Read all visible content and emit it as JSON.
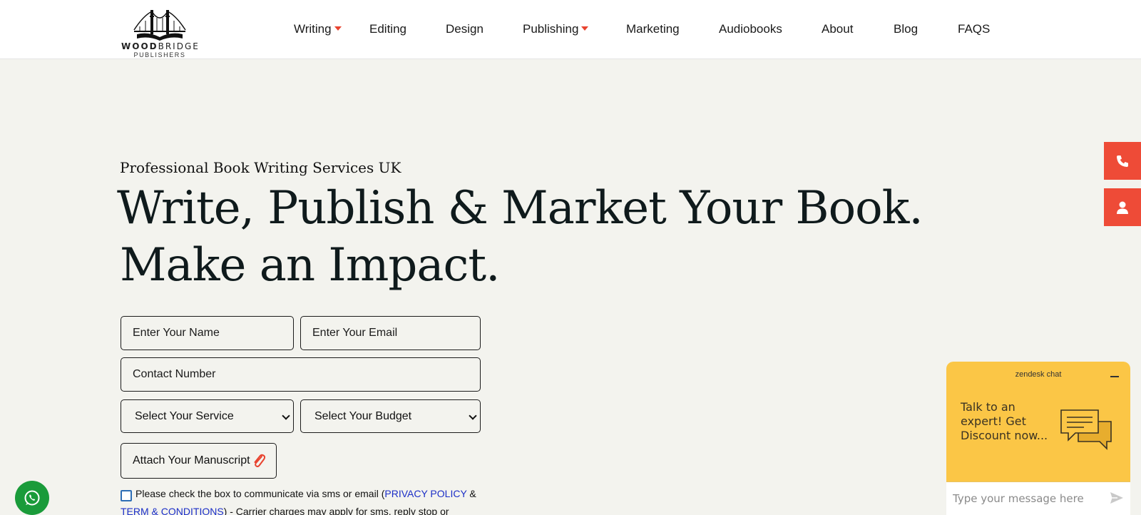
{
  "brand": {
    "logo_main_bold": "WOOD",
    "logo_main_light": "BRIDGE",
    "logo_sub": "PUBLISHERS"
  },
  "nav": {
    "items": [
      {
        "label": "Writing",
        "has_dropdown": true
      },
      {
        "label": "Editing",
        "has_dropdown": false
      },
      {
        "label": "Design",
        "has_dropdown": false
      },
      {
        "label": "Publishing",
        "has_dropdown": true
      },
      {
        "label": "Marketing",
        "has_dropdown": false
      },
      {
        "label": "Audiobooks",
        "has_dropdown": false
      },
      {
        "label": "About",
        "has_dropdown": false
      },
      {
        "label": "Blog",
        "has_dropdown": false
      },
      {
        "label": "FAQS",
        "has_dropdown": false
      }
    ]
  },
  "hero": {
    "eyebrow": "Professional Book Writing Services UK",
    "headline_line1": "Write, Publish & Market Your Book.",
    "headline_line2": "Make an Impact."
  },
  "form": {
    "name_placeholder": "Enter Your Name",
    "email_placeholder": "Enter Your Email",
    "phone_placeholder": "Contact Number",
    "service_selected": "Select Your Service",
    "budget_selected": "Select Your Budget",
    "attach_label": "Attach Your Manuscript",
    "consent_prefix": "Please check the box to communicate via sms or email (",
    "privacy_link": "PRIVACY POLICY",
    "consent_amp": " &",
    "terms_link": "TERM & CONDITIONS",
    "consent_suffix": ") - Carrier charges may apply for sms, reply stop or"
  },
  "chat": {
    "brand": "zendesk chat",
    "message": "Talk to an expert! Get Discount now...",
    "input_placeholder": "Type your message here"
  },
  "colors": {
    "accent": "#ee4b37",
    "chat_bg": "#fbc646",
    "whatsapp": "#1a9b3a",
    "link": "#1c2fc7",
    "page_bg": "#f3f3ee"
  },
  "icons": {
    "side_top": "phone-icon",
    "side_bottom": "user-icon",
    "whatsapp": "whatsapp-icon",
    "attach": "paperclip-icon",
    "chat_send": "send-icon"
  }
}
